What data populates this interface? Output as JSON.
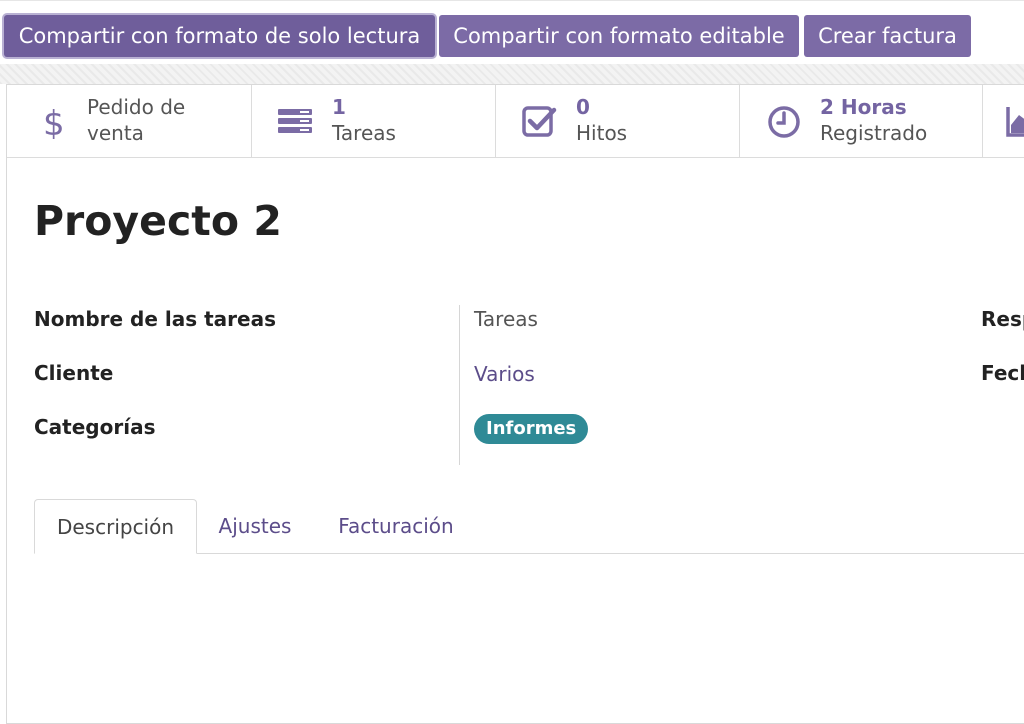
{
  "actions": {
    "share_readonly": "Compartir con formato de solo lectura",
    "share_editable": "Compartir con formato editable",
    "create_invoice": "Crear factura"
  },
  "smart_buttons": {
    "sale_order": {
      "line1": "Pedido de",
      "line2": "venta",
      "icon": "dollar-icon"
    },
    "tasks": {
      "value": "1",
      "label": "Tareas",
      "icon": "tasks-icon"
    },
    "milestones": {
      "value": "0",
      "label": "Hitos",
      "icon": "check-square-icon"
    },
    "hours": {
      "value": "2 Horas",
      "label": "Registrado",
      "icon": "clock-icon"
    },
    "more": {
      "icon": "area-chart-icon"
    }
  },
  "record": {
    "title": "Proyecto 2",
    "fields": {
      "task_name_label": "Nombre de las tareas",
      "task_name_value": "Tareas",
      "customer_label": "Cliente",
      "customer_value": "Varios",
      "tags_label": "Categorías",
      "tags_value": "Informes",
      "right_label_1": "Resp",
      "right_label_2": "Fech"
    }
  },
  "tabs": {
    "description": "Descripción",
    "settings": "Ajustes",
    "invoicing": "Facturación"
  },
  "colors": {
    "primary": "#7c6ba6",
    "link": "#5c4d8a",
    "tag": "#2f8a96"
  }
}
